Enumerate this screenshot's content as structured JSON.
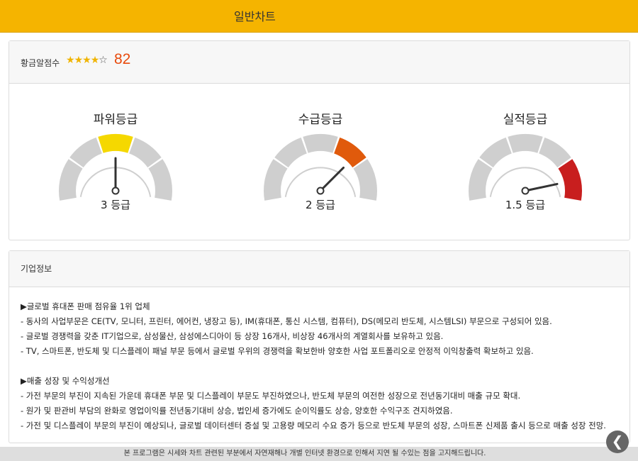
{
  "header": {
    "title": "일반차트"
  },
  "score": {
    "label": "황금알점수",
    "stars_filled": 4,
    "stars_total": 5,
    "value": "82"
  },
  "gauges": [
    {
      "title": "파워등급",
      "value_text": "3 등급",
      "active_segment": 3,
      "needle_angle_deg": 0,
      "active_color": "#f5d800"
    },
    {
      "title": "수급등급",
      "value_text": "2 등급",
      "active_segment": 4,
      "needle_angle_deg": 45,
      "active_color": "#e05a0c"
    },
    {
      "title": "실적등급",
      "value_text": "1.5 등급",
      "active_segment": 5,
      "needle_angle_deg": 78,
      "active_color": "#c81e1e"
    }
  ],
  "info": {
    "label": "기업정보",
    "lines": [
      "▶글로벌 휴대폰 판매 점유율 1위 업체",
      "- 동사의 사업부문은 CE(TV, 모니터, 프린터, 에어컨, 냉장고 등), IM(휴대폰, 통신 시스템, 컴퓨터), DS(메모리 반도체, 시스템LSI) 부문으로 구성되어 있음.",
      "- 글로벌 경쟁력을 갖춘 IT기업으로, 삼성물산, 삼성에스디아이 등 상장 16개사, 비상장 46개사의 계열회사를 보유하고 있음.",
      "- TV, 스마트폰, 반도체 및 디스플레이 패널 부문 등에서 글로벌 우위의 경쟁력을 확보한바 양호한 사업 포트폴리오로 안정적 이익창출력 확보하고 있음.",
      "",
      "▶매출 성장 및 수익성개선",
      "- 가전 부문의 부진이 지속된 가운데 휴대폰 부문 및 디스플레이 부문도 부진하였으나, 반도체 부문의 여전한 성장으로 전년동기대비 매출 규모 확대.",
      "- 원가 및 판관비 부담의 완화로 영업이익률 전년동기대비 상승, 법인세 증가에도 순이익률도 상승, 양호한 수익구조 견지하였음.",
      "- 가전 및 디스플레이 부문의 부진이 예상되나, 글로벌 데이터센터 증설 및 고용량 메모리 수요 증가 등으로 반도체 부문의 성장, 스마트폰 신제품 출시 등으로 매출 성장 전망."
    ]
  },
  "footer": {
    "notice": "본 프로그램은 시세와 차트 관련된 부분에서 자연재해나 개별 인터넷 환경으로 인해서 지연 될 수있는 점을 고지해드립니다."
  },
  "back_button": {
    "icon": "chevron-left-icon",
    "glyph": "❮"
  },
  "colors": {
    "header": "#f5b400",
    "segment_gray": "#cfcfcf",
    "score": "#e84a0c"
  }
}
